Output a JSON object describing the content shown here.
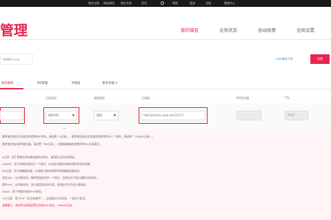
{
  "topbar": {
    "items": [
      "域名注册",
      "网站建设",
      "域名交易",
      "资讯",
      "帮助",
      "登录",
      "注册",
      "管理中心"
    ]
  },
  "header": {
    "logo": "管理",
    "nav": [
      "我的域名",
      "业务状态",
      "自动续费",
      "全局设置"
    ]
  },
  "domain_row": {
    "domain": "1688XX.com",
    "link": "com域名介绍",
    "login": "续费"
  },
  "tabs": [
    "域名解析",
    "NS管理",
    "子域名",
    "更多功能"
  ],
  "table_header": {
    "record_type": "记录类型",
    "line_type": "线路类型",
    "record_value": "记录值",
    "mx": "MX优先级",
    "ttl": "TTL"
  },
  "form": {
    "record_type": "隐性URL",
    "line_type": "通用",
    "record_value": "http://jimimu.wicp.net:22117",
    "ttl": "3600"
  },
  "tips": [
    {
      "text": "要将域名指向主机服务商提供的IP地址，请选择「A记录」，要将域名指向主机服务商提供的另一个域名，请选择「CNAME记录」。",
      "red": false
    },
    {
      "text": "要将域名指向邮件服务器，请设置「MX记录」，根据邮箱服务商提供的MX记录填写。",
      "red": false
    },
    {
      "text": "A记录：用于将域名指向服务器的IP地址，使用此记录访问网站。",
      "red": false
    },
    {
      "text": "CNAME：用于将域名指向另一个域名，以实现与被指向域名相同的访问效果。",
      "red": false
    },
    {
      "text": "MX记录：用于邮箱服务器，记录值为服务商提供的邮箱服务器地址。",
      "red": false
    },
    {
      "text": "显性URL：访问域名时，跳转到指定的另一个网址，且地址栏中显示跳转后的地址。",
      "red": false
    },
    {
      "text": "隐性URL：访问域名时，显示指定网址的内容，但地址栏中仍显示原域名。",
      "red": false
    },
    {
      "text": "AAAA：用于将域名指向IPv6地址。",
      "red": false
    },
    {
      "text": "TXT记录：用于SPF（反垃圾邮件），记录值为文本信息，一般用于验证。",
      "red": false
    },
    {
      "text": "温馨提示：请勿将记录值设置为其他URL网站，CNAME记录。",
      "red": true
    }
  ]
}
